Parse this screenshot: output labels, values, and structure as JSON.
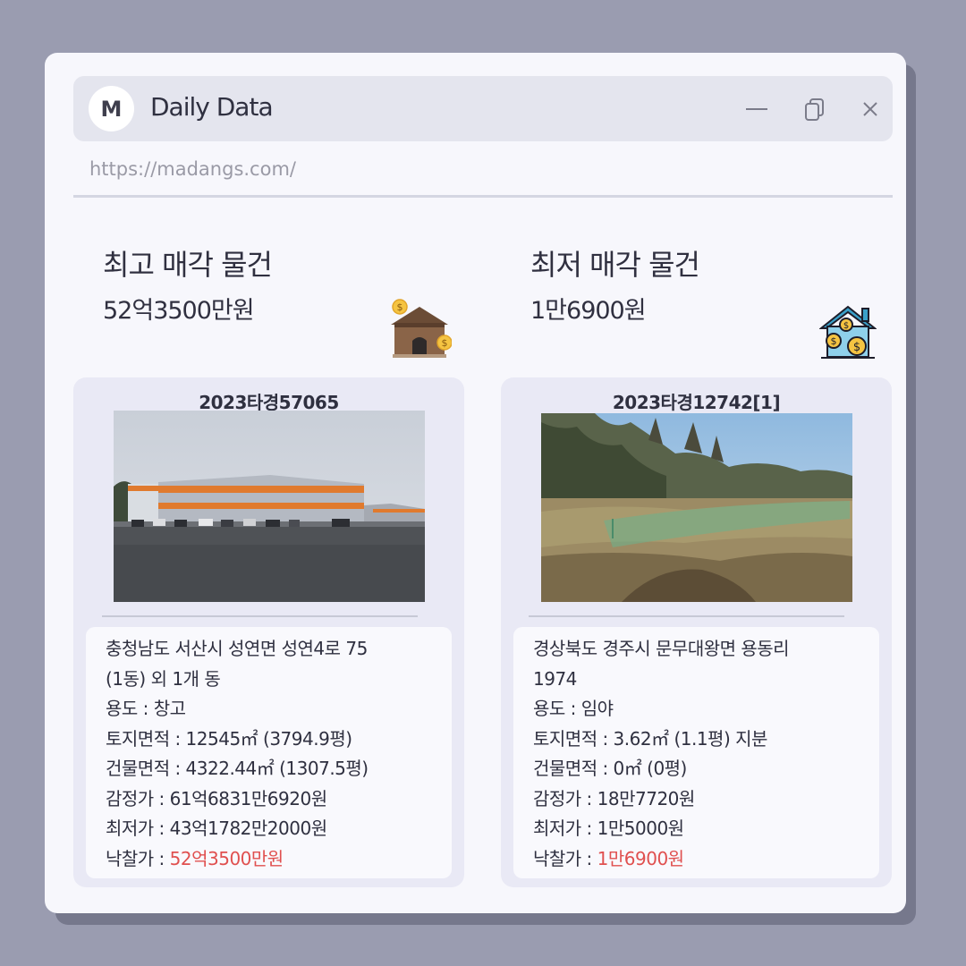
{
  "app": {
    "logo_letter": "M",
    "title": "Daily Data",
    "url": "https://madangs.com/"
  },
  "window_controls": [
    "minimize-icon",
    "duplicate-icon",
    "close-icon"
  ],
  "highest": {
    "heading": "최고 매각 물건",
    "amount": "52억3500만원",
    "icon": "house-money-icon",
    "case_id": "2023타경57065",
    "address_line1": "충청남도 서산시 성연면 성연4로 75",
    "address_line2": "(1동) 외 1개 동",
    "usage": "용도 : 창고",
    "land_area": "토지면적 : 12545㎡ (3794.9평)",
    "building_area": "건물면적 : 4322.44㎡ (1307.5평)",
    "appraisal": "감정가 : 61억6831만6920원",
    "minimum": "최저가 : 43억1782만2000원",
    "sold_label": "낙찰가 : ",
    "sold_price": "52억3500만원"
  },
  "lowest": {
    "heading": "최저 매각 물건",
    "amount": "1만6900원",
    "icon": "house-coins-icon",
    "case_id": "2023타경12742[1]",
    "address_line1": "경상북도 경주시 문무대왕면 용동리",
    "address_line2": "1974",
    "usage": "용도 : 임야",
    "land_area": "토지면적 : 3.62㎡ (1.1평) 지분",
    "building_area": "건물면적 : 0㎡ (0평)",
    "appraisal": "감정가 :  18만7720원",
    "minimum": "최저가 : 1만5000원",
    "sold_label": "낙찰가 : ",
    "sold_price": "1만6900원"
  },
  "colors": {
    "background": "#9a9cb0",
    "window": "#f7f7fc",
    "titlebar": "#e4e5ee",
    "card": "#e9e9f5",
    "price_red": "#e0504f"
  }
}
